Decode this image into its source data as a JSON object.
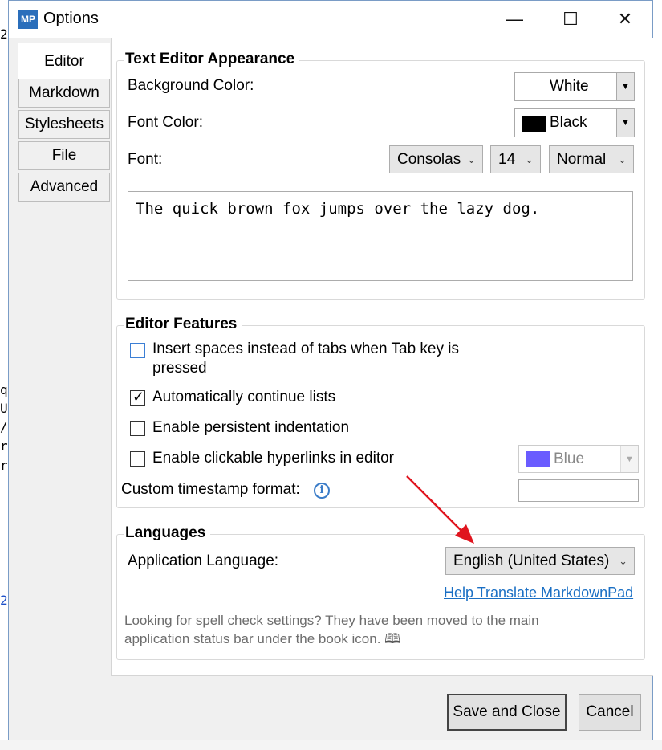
{
  "window": {
    "app_icon_text": "MP",
    "title": "Options",
    "minimize_glyph": "—",
    "maximize_glyph": "☐",
    "close_glyph": "✕"
  },
  "tabs": [
    {
      "label": "Editor",
      "active": true
    },
    {
      "label": "Markdown",
      "active": false
    },
    {
      "label": "Stylesheets",
      "active": false
    },
    {
      "label": "File",
      "active": false
    },
    {
      "label": "Advanced",
      "active": false
    }
  ],
  "appearance": {
    "legend": "Text Editor Appearance",
    "background_label": "Background Color:",
    "background_value": "White",
    "font_color_label": "Font Color:",
    "font_color_value": "Black",
    "font_color_swatch": "#000000",
    "font_label": "Font:",
    "font_family": "Consolas",
    "font_size": "14",
    "font_weight": "Normal",
    "preview_text": "The quick brown fox jumps over the lazy dog."
  },
  "features": {
    "legend": "Editor Features",
    "insert_spaces_label_line1": "Insert spaces instead of tabs when Tab key is",
    "insert_spaces_label_line2": "pressed",
    "insert_spaces_checked": false,
    "continue_lists_label": "Automatically continue lists",
    "continue_lists_checked": true,
    "persistent_indent_label": "Enable persistent indentation",
    "persistent_indent_checked": false,
    "hyperlinks_label": "Enable clickable hyperlinks in editor",
    "hyperlinks_checked": false,
    "hyperlink_color_value": "Blue",
    "hyperlink_color_swatch": "#6a5cff",
    "timestamp_label": "Custom timestamp format:",
    "timestamp_value": ""
  },
  "languages": {
    "legend": "Languages",
    "app_language_label": "Application Language:",
    "app_language_value": "English (United States)",
    "translate_link": "Help Translate MarkdownPad",
    "spellcheck_note_line1": "Looking for spell check settings? They have been moved to the main",
    "spellcheck_note_line2": "application status bar under the book icon."
  },
  "footer": {
    "save_label": "Save and Close",
    "cancel_label": "Cancel"
  },
  "annotation": {
    "arrow_color": "#e0141e"
  },
  "background_fragments": {
    "left_chars": [
      "q",
      "U",
      "/",
      "r",
      "r"
    ],
    "left_top": "2",
    "left_mid": "2"
  }
}
